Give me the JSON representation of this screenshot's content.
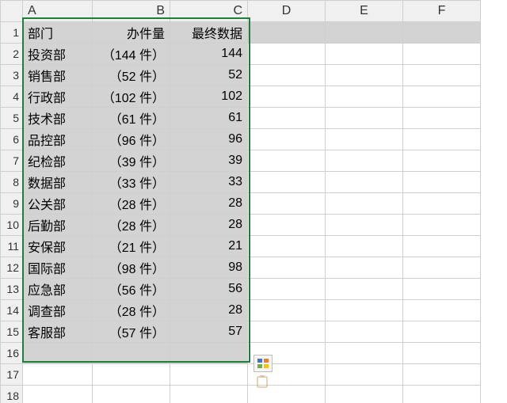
{
  "columns": [
    "A",
    "B",
    "C",
    "D",
    "E",
    "F"
  ],
  "row_numbers": [
    "1",
    "2",
    "3",
    "4",
    "5",
    "6",
    "7",
    "8",
    "9",
    "10",
    "11",
    "12",
    "13",
    "14",
    "15",
    "16",
    "17",
    "18"
  ],
  "headers": {
    "A": "部门",
    "B": "办件量",
    "C": "最终数据"
  },
  "rows": [
    {
      "A": "投资部",
      "B": "（144 件）",
      "C": "144"
    },
    {
      "A": "销售部",
      "B": "（52 件）",
      "C": "52"
    },
    {
      "A": "行政部",
      "B": "（102 件）",
      "C": "102"
    },
    {
      "A": "技术部",
      "B": "（61 件）",
      "C": "61"
    },
    {
      "A": "品控部",
      "B": "（96 件）",
      "C": "96"
    },
    {
      "A": "纪检部",
      "B": "（39 件）",
      "C": "39"
    },
    {
      "A": "数据部",
      "B": "（33 件）",
      "C": "33"
    },
    {
      "A": "公关部",
      "B": "（28 件）",
      "C": "28"
    },
    {
      "A": "后勤部",
      "B": "（28 件）",
      "C": "28"
    },
    {
      "A": "安保部",
      "B": "（21 件）",
      "C": "21"
    },
    {
      "A": "国际部",
      "B": "（98 件）",
      "C": "98"
    },
    {
      "A": "应急部",
      "B": "（56 件）",
      "C": "56"
    },
    {
      "A": "调查部",
      "B": "（28 件）",
      "C": "28"
    },
    {
      "A": "客服部",
      "B": "（57 件）",
      "C": "57"
    }
  ],
  "chart_data": {
    "type": "table",
    "title": "",
    "columns": [
      "部门",
      "办件量",
      "最终数据"
    ],
    "records": [
      [
        "投资部",
        "（144 件）",
        144
      ],
      [
        "销售部",
        "（52 件）",
        52
      ],
      [
        "行政部",
        "（102 件）",
        102
      ],
      [
        "技术部",
        "（61 件）",
        61
      ],
      [
        "品控部",
        "（96 件）",
        96
      ],
      [
        "纪检部",
        "（39 件）",
        39
      ],
      [
        "数据部",
        "（33 件）",
        33
      ],
      [
        "公关部",
        "（28 件）",
        28
      ],
      [
        "后勤部",
        "（28 件）",
        28
      ],
      [
        "安保部",
        "（21 件）",
        21
      ],
      [
        "国际部",
        "（98 件）",
        98
      ],
      [
        "应急部",
        "（56 件）",
        56
      ],
      [
        "调查部",
        "（28 件）",
        28
      ],
      [
        "客服部",
        "（57 件）",
        57
      ]
    ]
  }
}
